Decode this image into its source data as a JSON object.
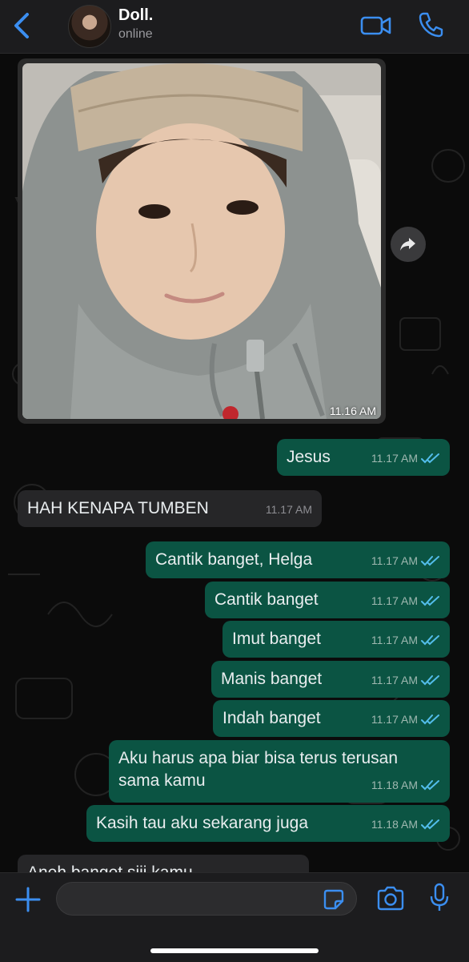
{
  "header": {
    "back_icon": "chevron-left-icon",
    "contact_name": "Doll.",
    "contact_status": "online",
    "video_icon": "video-camera-icon",
    "call_icon": "phone-icon"
  },
  "colors": {
    "accent": "#3b8ef0",
    "outgoing_bubble": "#0b5443",
    "incoming_bubble": "#262628",
    "read_ticks": "#53bdeb"
  },
  "photo_message": {
    "time": "11.16 AM",
    "forward_icon": "forward-arrow-icon"
  },
  "messages": [
    {
      "dir": "out",
      "text": "Jesus",
      "time": "11.17 AM"
    },
    {
      "dir": "in",
      "text": "HAH KENAPA TUMBEN",
      "time": "11.17 AM"
    },
    {
      "dir": "out",
      "text": "Cantik banget, Helga",
      "time": "11.17 AM"
    },
    {
      "dir": "out",
      "text": "Cantik banget",
      "time": "11.17 AM"
    },
    {
      "dir": "out",
      "text": "Imut banget",
      "time": "11.17 AM"
    },
    {
      "dir": "out",
      "text": "Manis banget",
      "time": "11.17 AM"
    },
    {
      "dir": "out",
      "text": "Indah banget",
      "time": "11.17 AM"
    },
    {
      "dir": "out",
      "text": "Aku harus apa biar bisa terus terusan\nsama kamu",
      "time": "11.18 AM"
    },
    {
      "dir": "out",
      "text": "Kasih tau aku sekarang juga",
      "time": "11.18 AM"
    },
    {
      "dir": "in",
      "text": "Aneh banget siii kamu",
      "time": ""
    }
  ],
  "input": {
    "plus_icon": "plus-icon",
    "value": "",
    "sticker_icon": "sticker-icon",
    "camera_icon": "camera-icon",
    "mic_icon": "microphone-icon"
  }
}
